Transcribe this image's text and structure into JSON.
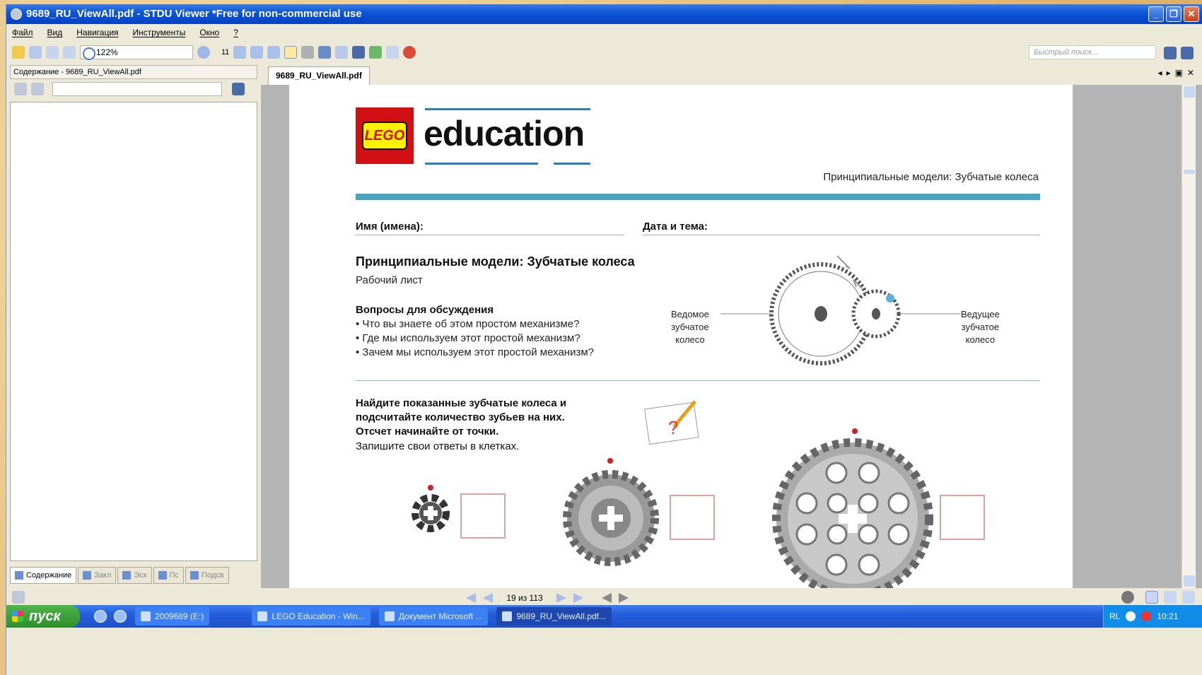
{
  "window": {
    "title": "9689_RU_ViewAll.pdf - STDU Viewer *Free for non-commercial use",
    "buttons": [
      "_",
      "❐",
      "✕"
    ]
  },
  "menu": [
    "Файл",
    "Вид",
    "Навигация",
    "Инструменты",
    "Окно",
    "?"
  ],
  "toolbar": {
    "zoom": "122%",
    "page_field": "11",
    "quick_search_placeholder": "Быстрый поиск..."
  },
  "left_panel": {
    "title": "Содержание - 9689_RU_ViewAll.pdf",
    "tabs": [
      "Содержание",
      "Закл",
      "Эск",
      "Пс",
      "Подсв"
    ]
  },
  "document": {
    "tab_label": "9689_RU_ViewAll.pdf",
    "logo_text": "LEGO",
    "brand": "education",
    "header_right": "Принципиальные модели: Зубчатые колеса",
    "name_label": "Имя (имена):",
    "date_label": "Дата и тема:",
    "title": "Принципиальные модели: Зубчатые колеса",
    "subtitle": "Рабочий лист",
    "questions_heading": "Вопросы для обсуждения",
    "questions": [
      "• Что вы знаете об этом простом механизме?",
      "• Где мы используем этот простой механизм?",
      "• Зачем мы используем этот простой механизм?"
    ],
    "driven_gear_label": [
      "Ведомое",
      "зубчатое",
      "колесо"
    ],
    "driving_gear_label": [
      "Ведущее",
      "зубчатое",
      "колесо"
    ],
    "task_lines": [
      "Найдите показанные зубчатые колеса и",
      "подсчитайте количество зубьев на них.",
      "Отсчет начинайте от точки.",
      "Запишите свои ответы в клетках."
    ]
  },
  "status": {
    "page_indicator": "19 из 113"
  },
  "taskbar": {
    "start": "пуск",
    "items": [
      "2009689 (E:)",
      "LEGO Education - Win...",
      "Документ Microsoft ...",
      "9689_RU_ViewAll.pdf..."
    ],
    "lang": "RL",
    "clock": "10:21"
  }
}
